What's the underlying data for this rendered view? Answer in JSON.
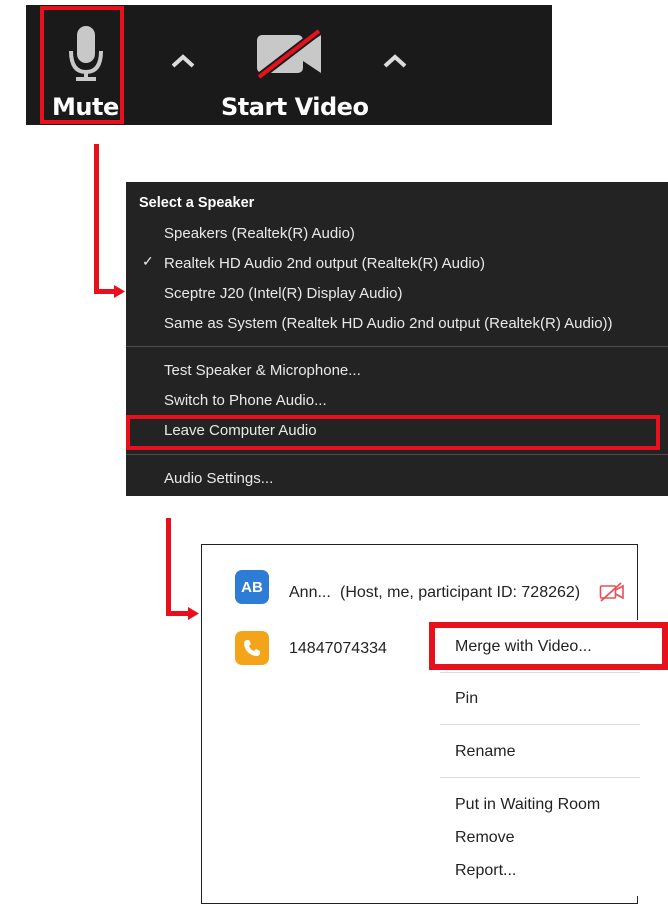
{
  "toolbar": {
    "mute_label": "Mute",
    "start_video_label": "Start Video",
    "icons": [
      "microphone-icon",
      "chevron-up-icon",
      "video-off-icon",
      "chevron-up-icon"
    ]
  },
  "audio_menu": {
    "header": "Select a Speaker",
    "speakers": [
      {
        "label": "Speakers (Realtek(R) Audio)",
        "checked": false
      },
      {
        "label": "Realtek HD Audio 2nd output (Realtek(R) Audio)",
        "checked": true
      },
      {
        "label": "Sceptre J20 (Intel(R) Display Audio)",
        "checked": false
      },
      {
        "label": "Same as System (Realtek HD Audio 2nd output (Realtek(R) Audio))",
        "checked": false
      }
    ],
    "check_mark": "✓",
    "test_label": "Test Speaker & Microphone...",
    "switch_label": "Switch to Phone Audio...",
    "leave_label": "Leave Computer Audio",
    "settings_label": "Audio Settings..."
  },
  "participants": {
    "p1": {
      "initials": "AB",
      "name": "Ann...",
      "info": "(Host, me, participant ID: 728262)"
    },
    "p2": {
      "name": "14847074334"
    }
  },
  "context_menu": {
    "merge": "Merge with Video...",
    "pin": "Pin",
    "rename": "Rename",
    "waiting": "Put in Waiting Room",
    "remove": "Remove",
    "report": "Report..."
  },
  "colors": {
    "highlight": "#e8101b",
    "toolbar_bg": "#1a1a1a",
    "menu_bg": "#232323",
    "avatar_blue": "#2d7cd6",
    "avatar_orange": "#f3a418"
  }
}
